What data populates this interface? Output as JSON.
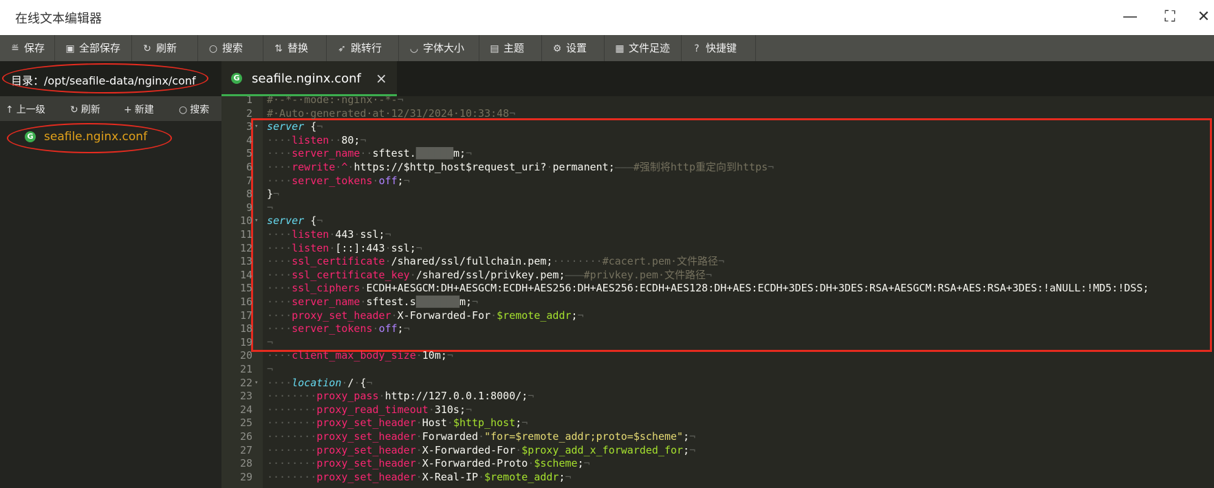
{
  "window": {
    "title": "在线文本编辑器",
    "minimize": "—",
    "maximize": "⛶",
    "close": "✕"
  },
  "toolbar": [
    {
      "label": "保存",
      "icon": "≝",
      "name": "save"
    },
    {
      "label": "全部保存",
      "icon": "▣",
      "name": "save-all"
    },
    {
      "label": "刷新",
      "icon": "↻",
      "name": "refresh"
    },
    {
      "label": "搜索",
      "icon": "○",
      "name": "search"
    },
    {
      "label": "替换",
      "icon": "⇅",
      "name": "replace"
    },
    {
      "label": "跳转行",
      "icon": "➶",
      "name": "goto-line"
    },
    {
      "label": "字体大小",
      "icon": "◡",
      "name": "font-size"
    },
    {
      "label": "主题",
      "icon": "▤",
      "name": "theme"
    },
    {
      "label": "设置",
      "icon": "⚙",
      "name": "settings"
    },
    {
      "label": "文件足迹",
      "icon": "▦",
      "name": "file-history"
    },
    {
      "label": "快捷键",
      "icon": "?",
      "name": "shortcuts"
    }
  ],
  "sidebar": {
    "directory_label": "目录：/opt/seafile-data/nginx/conf",
    "actions": [
      {
        "label": "上一级",
        "icon": "↑",
        "name": "up-level"
      },
      {
        "label": "刷新",
        "icon": "↻",
        "name": "refresh"
      },
      {
        "label": "新建",
        "icon": "+",
        "name": "new"
      },
      {
        "label": "搜索",
        "icon": "○",
        "name": "search"
      }
    ],
    "files": [
      {
        "name": "seafile.nginx.conf",
        "icon": "G"
      }
    ],
    "collapse_icon": "‹"
  },
  "tabs": [
    {
      "label": "seafile.nginx.conf",
      "close": "×",
      "icon": "G"
    }
  ],
  "colors": {
    "accent": "#3cae4e",
    "annotation": "#e52b1f",
    "file_highlight": "#e3a21a",
    "editor_bg": "#272822"
  },
  "editor": {
    "lines": [
      {
        "n": "1",
        "fold": "",
        "tokens": [
          [
            "c",
            "#·-*-·mode:·nginx·-*-"
          ],
          [
            "w",
            "¬"
          ]
        ]
      },
      {
        "n": "2",
        "fold": "",
        "tokens": [
          [
            "c",
            "#·Auto·generated·at·12/31/2024·10:33:48"
          ],
          [
            "w",
            "¬"
          ]
        ]
      },
      {
        "n": "3",
        "fold": "▾",
        "tokens": [
          [
            "k",
            "server"
          ],
          [
            "p",
            " {"
          ],
          [
            "w",
            "¬"
          ]
        ]
      },
      {
        "n": "4",
        "fold": "",
        "tokens": [
          [
            "w",
            "····"
          ],
          [
            "d",
            "listen"
          ],
          [
            "w",
            "··"
          ],
          [
            "p",
            "80;"
          ],
          [
            "w",
            "¬"
          ]
        ]
      },
      {
        "n": "5",
        "fold": "",
        "tokens": [
          [
            "w",
            "····"
          ],
          [
            "d",
            "server_name"
          ],
          [
            "w",
            "··"
          ],
          [
            "p",
            "sftest."
          ],
          [
            "w",
            "██████"
          ],
          [
            "p",
            "m;"
          ],
          [
            "w",
            "¬"
          ]
        ]
      },
      {
        "n": "6",
        "fold": "",
        "tokens": [
          [
            "w",
            "····"
          ],
          [
            "d",
            "rewrite"
          ],
          [
            "w",
            "·"
          ],
          [
            "d",
            "^"
          ],
          [
            "w",
            "·"
          ],
          [
            "p",
            "https://$http_host$request_uri?"
          ],
          [
            "w",
            "·"
          ],
          [
            "p",
            "permanent;"
          ],
          [
            "w",
            "———"
          ],
          [
            "c",
            "#强制将http重定向到https"
          ],
          [
            "w",
            "¬"
          ]
        ]
      },
      {
        "n": "7",
        "fold": "",
        "tokens": [
          [
            "w",
            "····"
          ],
          [
            "d",
            "server_tokens"
          ],
          [
            "w",
            "·"
          ],
          [
            "v",
            "off"
          ],
          [
            "p",
            ";"
          ],
          [
            "w",
            "¬"
          ]
        ]
      },
      {
        "n": "8",
        "fold": "",
        "tokens": [
          [
            "p",
            "}"
          ],
          [
            "w",
            "¬"
          ]
        ]
      },
      {
        "n": "9",
        "fold": "",
        "tokens": [
          [
            "w",
            "¬"
          ]
        ]
      },
      {
        "n": "10",
        "fold": "▾",
        "tokens": [
          [
            "k",
            "server"
          ],
          [
            "p",
            " {"
          ],
          [
            "w",
            "¬"
          ]
        ]
      },
      {
        "n": "11",
        "fold": "",
        "tokens": [
          [
            "w",
            "····"
          ],
          [
            "d",
            "listen"
          ],
          [
            "w",
            "·"
          ],
          [
            "p",
            "443"
          ],
          [
            "w",
            "·"
          ],
          [
            "p",
            "ssl;"
          ],
          [
            "w",
            "¬"
          ]
        ]
      },
      {
        "n": "12",
        "fold": "",
        "tokens": [
          [
            "w",
            "····"
          ],
          [
            "d",
            "listen"
          ],
          [
            "w",
            "·"
          ],
          [
            "p",
            "[::]:443"
          ],
          [
            "w",
            "·"
          ],
          [
            "p",
            "ssl;"
          ],
          [
            "w",
            "¬"
          ]
        ]
      },
      {
        "n": "13",
        "fold": "",
        "tokens": [
          [
            "w",
            "····"
          ],
          [
            "d",
            "ssl_certificate"
          ],
          [
            "w",
            "·"
          ],
          [
            "p",
            "/shared/ssl/fullchain.pem;"
          ],
          [
            "w",
            "········"
          ],
          [
            "c",
            "#cacert.pem·文件路径"
          ],
          [
            "w",
            "¬"
          ]
        ]
      },
      {
        "n": "14",
        "fold": "",
        "tokens": [
          [
            "w",
            "····"
          ],
          [
            "d",
            "ssl_certificate_key"
          ],
          [
            "w",
            "·"
          ],
          [
            "p",
            "/shared/ssl/privkey.pem;"
          ],
          [
            "w",
            "———"
          ],
          [
            "c",
            "#privkey.pem·文件路径"
          ],
          [
            "w",
            "¬"
          ]
        ]
      },
      {
        "n": "15",
        "fold": "",
        "tokens": [
          [
            "w",
            "····"
          ],
          [
            "d",
            "ssl_ciphers"
          ],
          [
            "w",
            "·"
          ],
          [
            "p",
            "ECDH+AESGCM:DH+AESGCM:ECDH+AES256:DH+AES256:ECDH+AES128:DH+AES:ECDH+3DES:DH+3DES:RSA+AESGCM:RSA+AES:RSA+3DES:!aNULL:!MD5:!DSS;"
          ]
        ]
      },
      {
        "n": "16",
        "fold": "",
        "tokens": [
          [
            "w",
            "····"
          ],
          [
            "d",
            "server_name"
          ],
          [
            "w",
            "·"
          ],
          [
            "p",
            "sftest.s"
          ],
          [
            "w",
            "███████"
          ],
          [
            "p",
            "m;"
          ],
          [
            "w",
            "¬"
          ]
        ]
      },
      {
        "n": "17",
        "fold": "",
        "tokens": [
          [
            "w",
            "····"
          ],
          [
            "d",
            "proxy_set_header"
          ],
          [
            "w",
            "·"
          ],
          [
            "p",
            "X-Forwarded-For"
          ],
          [
            "w",
            "·"
          ],
          [
            "g",
            "$remote_addr"
          ],
          [
            "p",
            ";"
          ],
          [
            "w",
            "¬"
          ]
        ]
      },
      {
        "n": "18",
        "fold": "",
        "tokens": [
          [
            "w",
            "····"
          ],
          [
            "d",
            "server_tokens"
          ],
          [
            "w",
            "·"
          ],
          [
            "v",
            "off"
          ],
          [
            "p",
            ";"
          ],
          [
            "w",
            "¬"
          ]
        ]
      },
      {
        "n": "19",
        "fold": "",
        "tokens": [
          [
            "w",
            "¬"
          ]
        ]
      },
      {
        "n": "20",
        "fold": "",
        "tokens": [
          [
            "w",
            "····"
          ],
          [
            "d",
            "client_max_body_size"
          ],
          [
            "w",
            "·"
          ],
          [
            "p",
            "10m;"
          ],
          [
            "w",
            "¬"
          ]
        ]
      },
      {
        "n": "21",
        "fold": "",
        "tokens": [
          [
            "w",
            "¬"
          ]
        ]
      },
      {
        "n": "22",
        "fold": "▾",
        "tokens": [
          [
            "w",
            "····"
          ],
          [
            "k",
            "location"
          ],
          [
            "w",
            "·"
          ],
          [
            "p",
            "/"
          ],
          [
            "w",
            "·"
          ],
          [
            "p",
            "{"
          ],
          [
            "w",
            "¬"
          ]
        ]
      },
      {
        "n": "23",
        "fold": "",
        "tokens": [
          [
            "w",
            "········"
          ],
          [
            "d",
            "proxy_pass"
          ],
          [
            "w",
            "·"
          ],
          [
            "p",
            "http://127.0.0.1:8000/;"
          ],
          [
            "w",
            "¬"
          ]
        ]
      },
      {
        "n": "24",
        "fold": "",
        "tokens": [
          [
            "w",
            "········"
          ],
          [
            "d",
            "proxy_read_timeout"
          ],
          [
            "w",
            "·"
          ],
          [
            "p",
            "310s;"
          ],
          [
            "w",
            "¬"
          ]
        ]
      },
      {
        "n": "25",
        "fold": "",
        "tokens": [
          [
            "w",
            "········"
          ],
          [
            "d",
            "proxy_set_header"
          ],
          [
            "w",
            "·"
          ],
          [
            "p",
            "Host"
          ],
          [
            "w",
            "·"
          ],
          [
            "g",
            "$http_host"
          ],
          [
            "p",
            ";"
          ],
          [
            "w",
            "¬"
          ]
        ]
      },
      {
        "n": "26",
        "fold": "",
        "tokens": [
          [
            "w",
            "········"
          ],
          [
            "d",
            "proxy_set_header"
          ],
          [
            "w",
            "·"
          ],
          [
            "p",
            "Forwarded"
          ],
          [
            "w",
            "·"
          ],
          [
            "s",
            "\"for=$remote_addr;proto=$scheme\""
          ],
          [
            "p",
            ";"
          ],
          [
            "w",
            "¬"
          ]
        ]
      },
      {
        "n": "27",
        "fold": "",
        "tokens": [
          [
            "w",
            "········"
          ],
          [
            "d",
            "proxy_set_header"
          ],
          [
            "w",
            "·"
          ],
          [
            "p",
            "X-Forwarded-For"
          ],
          [
            "w",
            "·"
          ],
          [
            "g",
            "$proxy_add_x_forwarded_for"
          ],
          [
            "p",
            ";"
          ],
          [
            "w",
            "¬"
          ]
        ]
      },
      {
        "n": "28",
        "fold": "",
        "tokens": [
          [
            "w",
            "········"
          ],
          [
            "d",
            "proxy_set_header"
          ],
          [
            "w",
            "·"
          ],
          [
            "p",
            "X-Forwarded-Proto"
          ],
          [
            "w",
            "·"
          ],
          [
            "g",
            "$scheme"
          ],
          [
            "p",
            ";"
          ],
          [
            "w",
            "¬"
          ]
        ]
      },
      {
        "n": "29",
        "fold": "",
        "tokens": [
          [
            "w",
            "········"
          ],
          [
            "d",
            "proxy_set_header"
          ],
          [
            "w",
            "·"
          ],
          [
            "p",
            "X-Real-IP"
          ],
          [
            "w",
            "·"
          ],
          [
            "g",
            "$remote_addr"
          ],
          [
            "p",
            ";"
          ],
          [
            "w",
            "¬"
          ]
        ]
      }
    ]
  }
}
